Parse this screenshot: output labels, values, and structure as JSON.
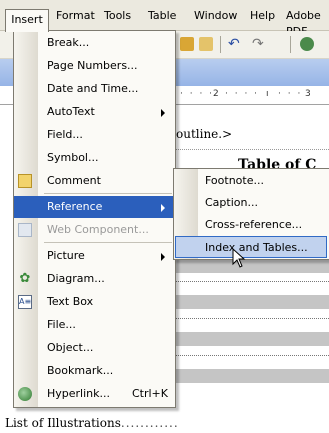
{
  "menubar": {
    "items": [
      "Insert",
      "Format",
      "Tools",
      "Table",
      "Window",
      "Help",
      "Adobe PDF"
    ]
  },
  "ruler": {
    "ticks": [
      "2",
      "3"
    ]
  },
  "document": {
    "outline_text": "outline.>",
    "heading_fragment": "Table of C",
    "list_of_illustrations": "List of Illustrations"
  },
  "insert_menu": {
    "items": [
      {
        "label": "Break...",
        "icon": "none"
      },
      {
        "label": "Page Numbers...",
        "icon": "none"
      },
      {
        "label": "Date and Time...",
        "icon": "none"
      },
      {
        "label": "AutoText",
        "icon": "none",
        "submenu": true
      },
      {
        "label": "Field...",
        "icon": "none"
      },
      {
        "label": "Symbol...",
        "icon": "none"
      },
      {
        "label": "Comment",
        "icon": "comment-icon"
      },
      {
        "label": "Reference",
        "icon": "none",
        "submenu": true,
        "highlighted": true
      },
      {
        "label": "Web Component...",
        "icon": "web-component-icon",
        "disabled": true
      },
      {
        "label": "Picture",
        "icon": "none",
        "submenu": true
      },
      {
        "label": "Diagram...",
        "icon": "diagram-icon"
      },
      {
        "label": "Text Box",
        "icon": "text-box-icon"
      },
      {
        "label": "File...",
        "icon": "none"
      },
      {
        "label": "Object...",
        "icon": "none"
      },
      {
        "label": "Bookmark...",
        "icon": "none"
      },
      {
        "label": "Hyperlink...",
        "icon": "hyperlink-icon",
        "shortcut": "Ctrl+K"
      }
    ]
  },
  "reference_submenu": {
    "items": [
      "Footnote...",
      "Caption...",
      "Cross-reference...",
      "Index and Tables..."
    ],
    "hovered": "Index and Tables..."
  }
}
